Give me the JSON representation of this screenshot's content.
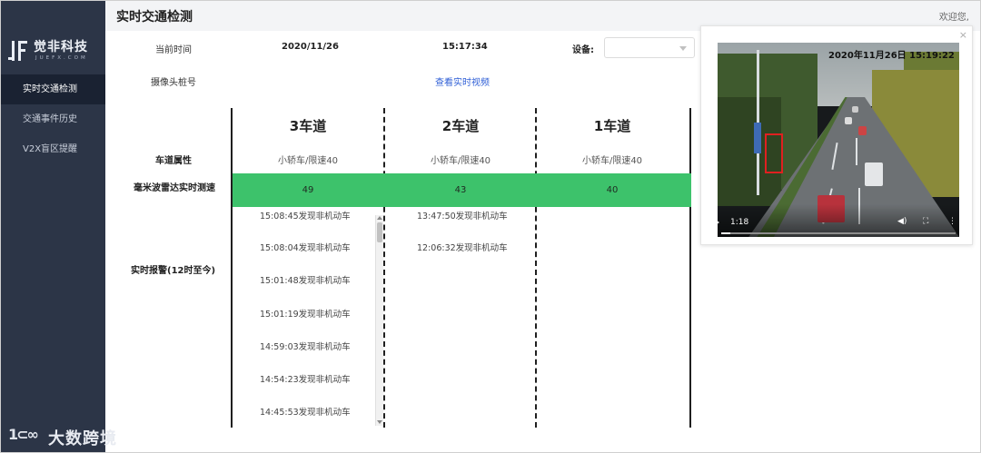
{
  "sidebar": {
    "logo_title": "觉非科技",
    "logo_sub": "JUEFX.COM",
    "items": [
      {
        "label": "实时交通检测"
      },
      {
        "label": "交通事件历史"
      },
      {
        "label": "V2X盲区提醒"
      }
    ],
    "active_index": 0
  },
  "header": {
    "title": "实时交通检测",
    "welcome": "欢迎您,"
  },
  "info": {
    "time_label": "当前时间",
    "date": "2020/11/26",
    "time": "15:17:34",
    "device_label": "设备:",
    "device_value": "",
    "camera_label": "摄像头桩号",
    "view_video_link": "查看实时视频"
  },
  "rows": {
    "lane_attr_label": "车道属性",
    "radar_label": "毫米波雷达实时测速",
    "alert_label": "实时报警(12时至今)"
  },
  "lanes": [
    {
      "name": "3车道",
      "attr": "小轿车/限速40",
      "speed": "49",
      "alerts": [
        "15:08:45发现非机动车",
        "15:08:04发现非机动车",
        "15:01:48发现非机动车",
        "15:01:19发现非机动车",
        "14:59:03发现非机动车",
        "14:54:23发现非机动车",
        "14:45:53发现非机动车"
      ]
    },
    {
      "name": "2车道",
      "attr": "小轿车/限速40",
      "speed": "43",
      "alerts": [
        "13:47:50发现非机动车",
        "12:06:32发现非机动车"
      ]
    },
    {
      "name": "1车道",
      "attr": "小轿车/限速40",
      "speed": "40",
      "alerts": []
    }
  ],
  "video": {
    "close": "×",
    "timestamp": "2020年11月26日  15:19:22",
    "elapsed": "1:18",
    "progress_fraction": 0.04
  },
  "watermark": {
    "icon_text": "1⊂∞",
    "text": "大数跨境"
  },
  "colors": {
    "sidebar_bg": "#2c3547",
    "active_item_bg": "#1a2232",
    "speed_band": "#3dc26b",
    "link": "#2f5fd6"
  }
}
